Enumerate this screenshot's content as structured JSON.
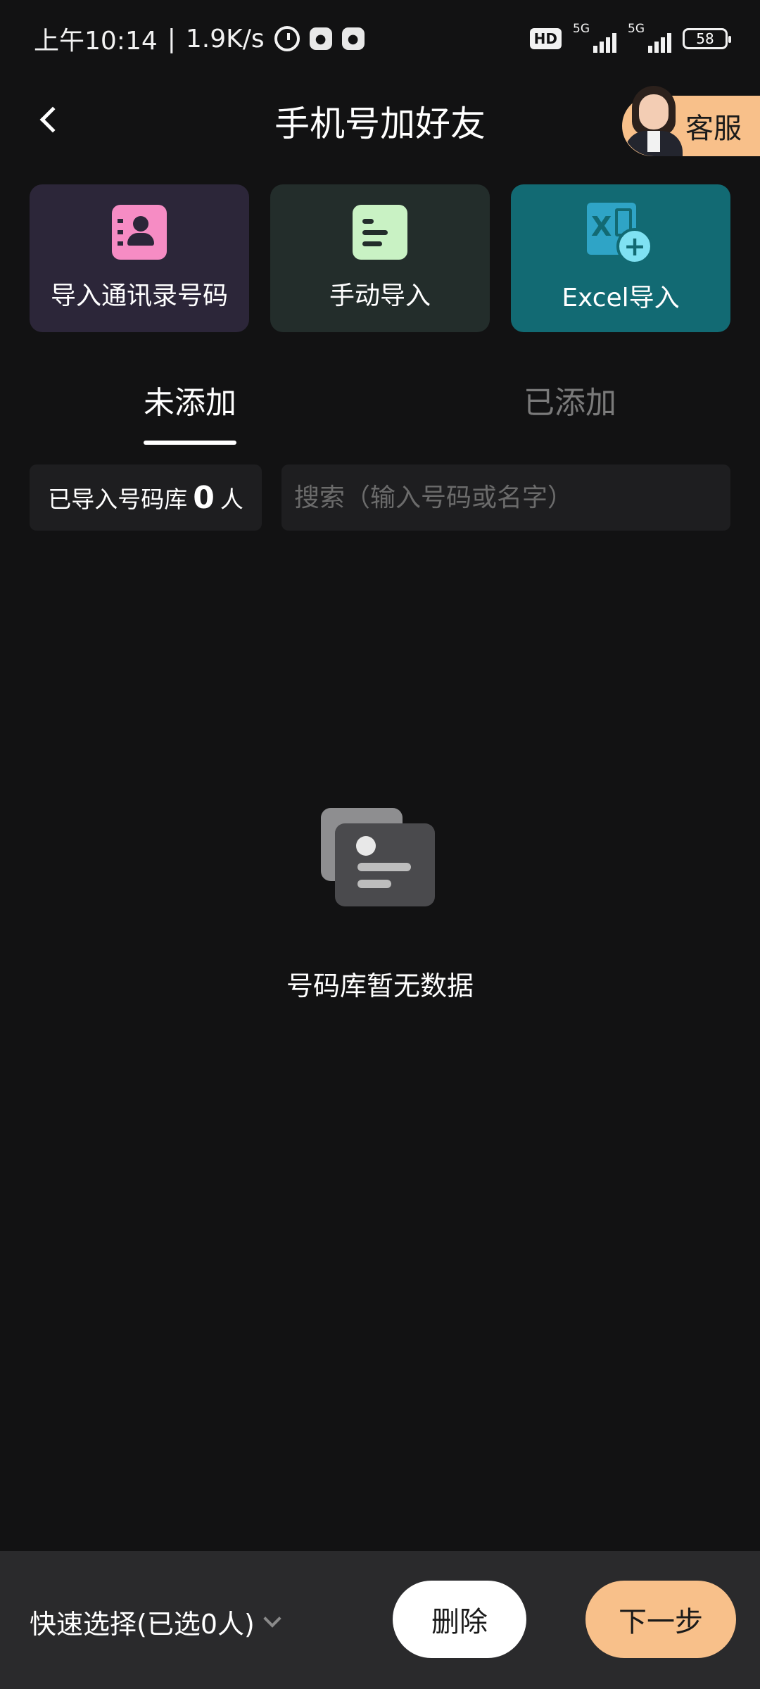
{
  "status_bar": {
    "time": "上午10:14",
    "separator": "|",
    "speed": "1.9K/s",
    "hd": "HD",
    "net1": "5G",
    "net2": "5G",
    "battery": "58"
  },
  "header": {
    "title": "手机号加好友",
    "service_label": "客服"
  },
  "import_cards": [
    {
      "label": "导入通讯录号码",
      "icon": "contacts-icon",
      "color": "#f68cc4"
    },
    {
      "label": "手动导入",
      "icon": "document-icon",
      "color": "#c9f2c4"
    },
    {
      "label": "Excel导入",
      "icon": "excel-icon",
      "color": "#2fa4c6"
    }
  ],
  "tabs": [
    {
      "label": "未添加",
      "active": true
    },
    {
      "label": "已添加",
      "active": false
    }
  ],
  "count": {
    "prefix": "已导入号码库",
    "value": "0",
    "suffix": "人"
  },
  "search": {
    "placeholder": "搜索（输入号码或名字）",
    "value": ""
  },
  "empty_state": {
    "text": "号码库暂无数据"
  },
  "bottom": {
    "quick_select": "快速选择(已选0人)",
    "delete_label": "删除",
    "next_label": "下一步"
  },
  "colors": {
    "background": "#121213",
    "accent": "#f8c08a",
    "excel_card": "#126a73"
  }
}
